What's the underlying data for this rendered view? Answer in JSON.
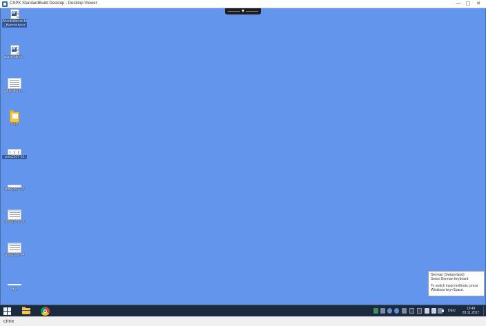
{
  "window": {
    "title": "CSPK StandardBuild Desktop - Desktop Viewer",
    "minimize_glyph": "—",
    "maximize_glyph": "□",
    "close_glyph": "✕"
  },
  "toolbar_tab": {
    "icon": "citrix-toolbar-handle-icon"
  },
  "desktop": {
    "background_color": "#6495ed",
    "icons": [
      {
        "label": "Arbeitsübersicht_Bericht.docx",
        "icon": "word-document-icon",
        "selected": true
      },
      {
        "label": "active_direc...",
        "icon": "word-document-icon",
        "selected": false
      },
      {
        "label": "addendum_...",
        "icon": "spreadsheet-file-icon",
        "selected": false
      },
      {
        "label": "certs",
        "icon": "folder-icon",
        "selected": false
      },
      {
        "label": "citrix2017-01",
        "icon": "image-file-icon",
        "selected": true
      },
      {
        "label": "citrix2017-02",
        "icon": "image-file-icon",
        "selected": false
      },
      {
        "label": "citrix2017-03",
        "icon": "image-file-icon",
        "selected": false
      },
      {
        "label": "citrix2017-04",
        "icon": "image-file-icon",
        "selected": false
      },
      {
        "label": "drc",
        "icon": "image-file-icon",
        "selected": false
      }
    ]
  },
  "ime_tooltip": {
    "language": "German (Switzerland)",
    "keyboard": "Swiss German keyboard",
    "hint_line1": "To switch input methods, press",
    "hint_line2": "Windows key+Space."
  },
  "taskbar": {
    "start_icon": "windows-start-icon",
    "pinned": [
      {
        "name": "file-explorer",
        "icon": "folder-icon"
      },
      {
        "name": "google-chrome",
        "icon": "chrome-icon"
      }
    ],
    "tray_icons": [
      "tray-app-icon",
      "tray-app-icon",
      "tray-update-icon",
      "tray-sync-icon",
      "tray-citrix-icon",
      "tray-monitor-icon",
      "tray-network-icon",
      "tray-flag-icon",
      "tray-display-icon",
      "tray-usb-icon",
      "tray-volume-icon"
    ],
    "language": "DEU",
    "time": "13:49",
    "date": "28.11.2017"
  },
  "footer": {
    "brand": "citrix"
  }
}
